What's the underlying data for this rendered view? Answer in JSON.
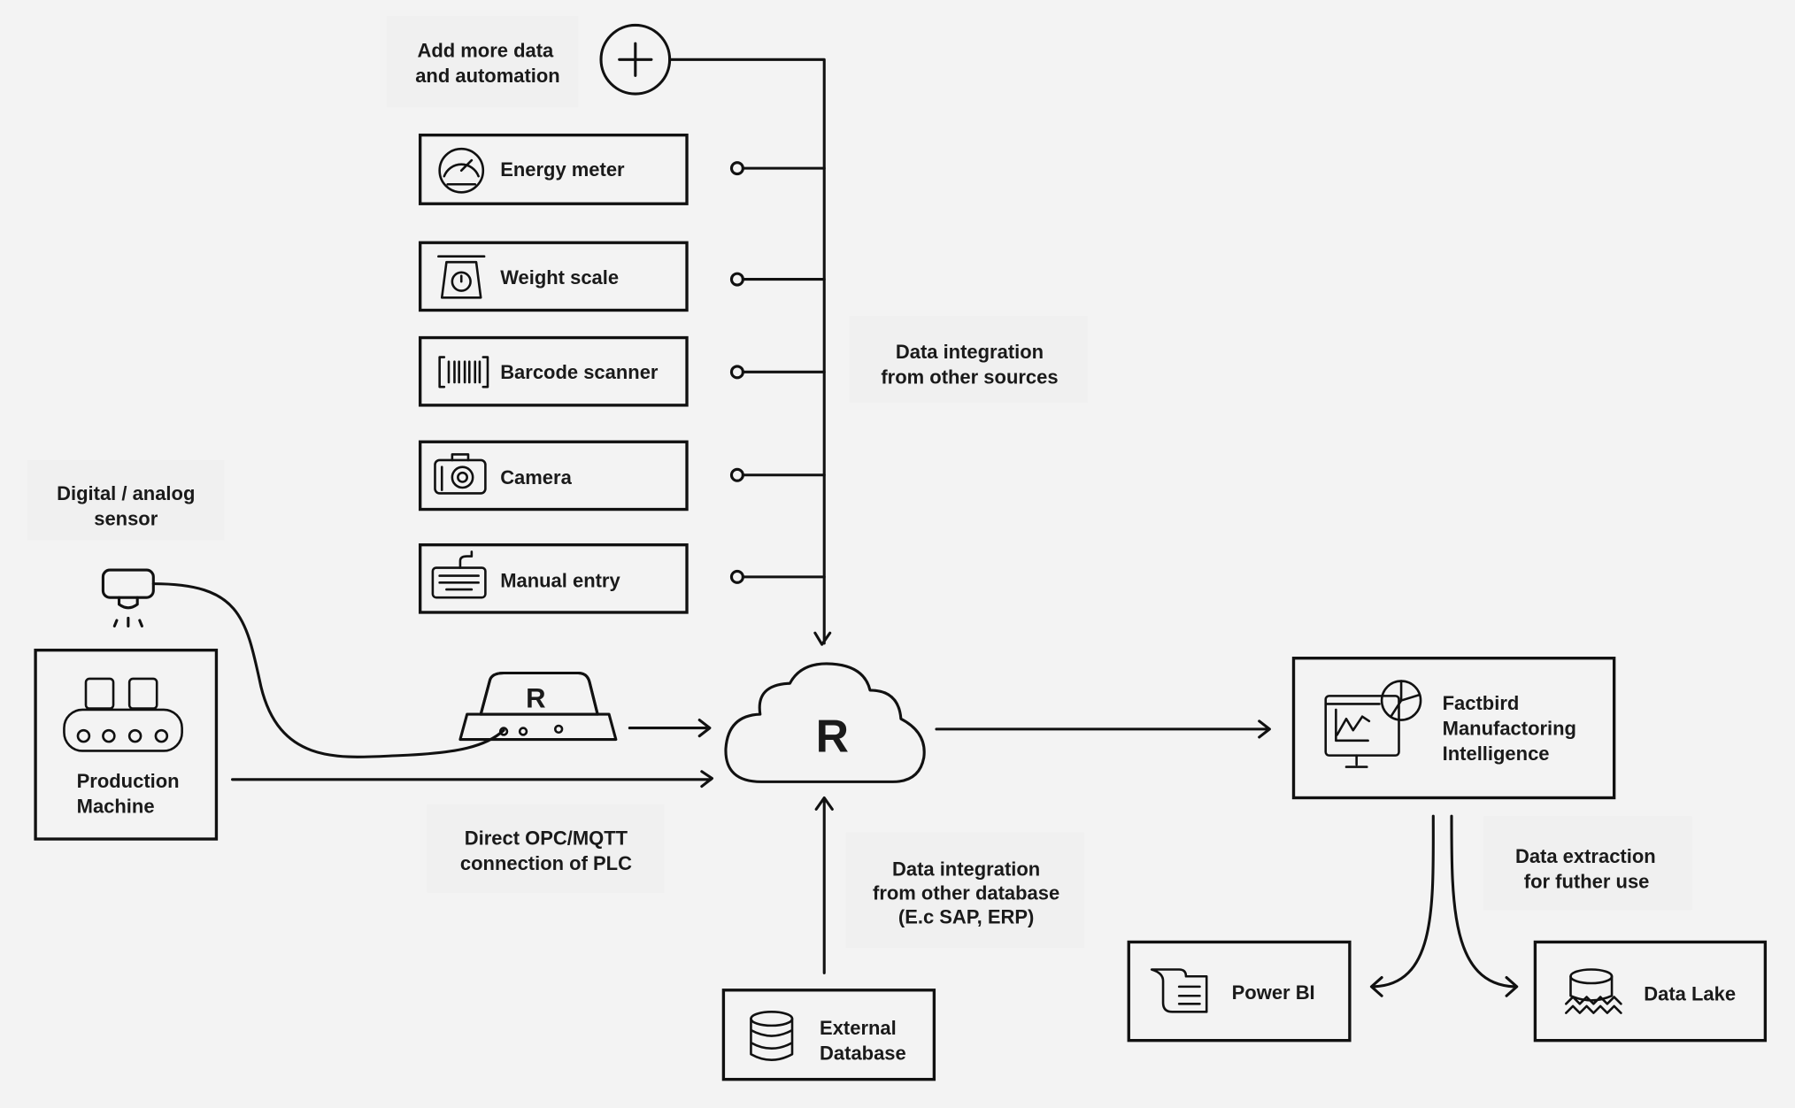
{
  "colors": {
    "background": "#f3f3f3",
    "cloud_fill": "#e6e3fa",
    "stroke": "#111111"
  },
  "add_more": {
    "line1": "Add more data",
    "line2": "and automation",
    "icon": "plus-circle-icon"
  },
  "devices": [
    {
      "label": "Energy meter",
      "icon": "gauge-icon"
    },
    {
      "label": "Weight scale",
      "icon": "scale-icon"
    },
    {
      "label": "Barcode scanner",
      "icon": "barcode-icon"
    },
    {
      "label": "Camera",
      "icon": "camera-icon"
    },
    {
      "label": "Manual entry",
      "icon": "keyboard-icon"
    }
  ],
  "labels": {
    "other_sources": {
      "line1": "Data integration",
      "line2": "from other sources"
    },
    "sensor": {
      "line1": "Digital / analog",
      "line2": "sensor"
    },
    "opc": {
      "line1": "Direct OPC/MQTT",
      "line2": "connection of PLC"
    },
    "other_db": {
      "line1": "Data integration",
      "line2": "from other database",
      "line3": "(E.c SAP, ERP)"
    },
    "extraction": {
      "line1": "Data extraction",
      "line2": "for futher use"
    }
  },
  "production_machine": {
    "line1": "Production",
    "line2": "Machine"
  },
  "external_db": {
    "line1": "External",
    "line2": "Database"
  },
  "factbird": {
    "line1": "Factbird",
    "line2": "Manufactoring",
    "line3": "Intelligence"
  },
  "power_bi": {
    "label": "Power BI"
  },
  "data_lake": {
    "label": "Data Lake"
  },
  "logo_letter": "R"
}
